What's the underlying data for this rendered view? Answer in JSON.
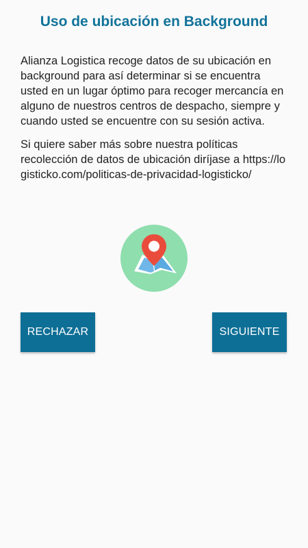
{
  "header": {
    "title": "Uso de ubicación en Background"
  },
  "body": {
    "paragraph_1": "Alianza Logistica recoge datos de su ubicación en background para así determinar si se encuentra usted en un lugar óptimo para recoger mercancía en alguno de nuestros centros de despacho, siempre y cuando usted se encuentre con su sesión activa.",
    "paragraph_2_text": "Si quiere saber más sobre nuestra políticas recolección de datos de ubicación diríjase a",
    "policy_url": "https://logisticko.com/politicas-de-privacidad-logisticko/"
  },
  "icon": {
    "name": "map-pin-icon",
    "circle_color": "#8fdeae",
    "pin_color": "#ea4c3c",
    "map_color": "#6fb7e8"
  },
  "actions": {
    "reject_label": "RECHAZAR",
    "next_label": "SIGUIENTE"
  },
  "colors": {
    "accent": "#0e6f96",
    "title": "#11739a",
    "background": "#fafafa"
  }
}
